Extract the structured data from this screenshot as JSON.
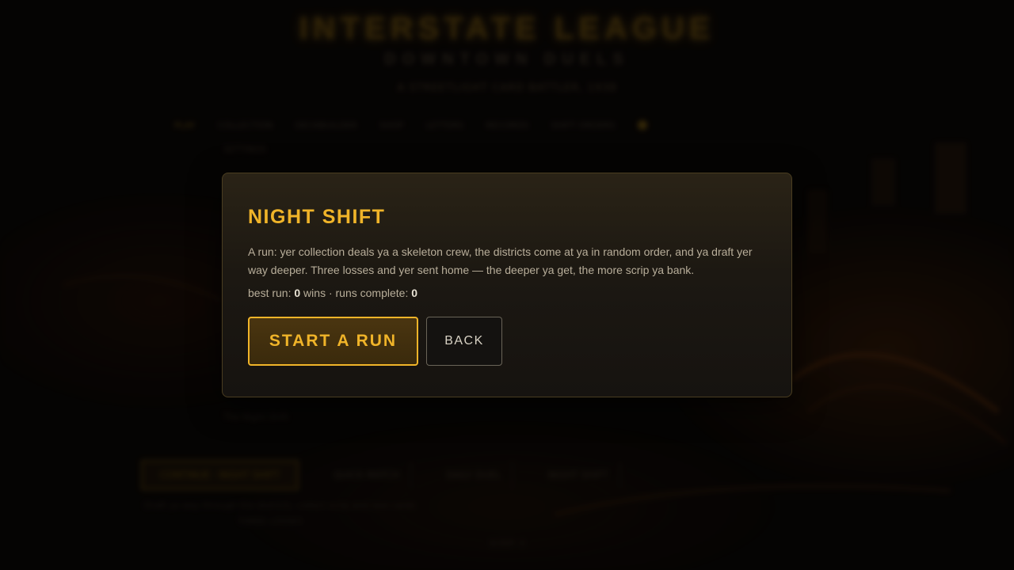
{
  "background": {
    "title": "INTERSTATE LEAGUE",
    "subtitle": "DOWNTOWN DUELS",
    "tagline": "A STREETLIGHT CARD BATTLER, 1938",
    "nav": [
      "PLAY",
      "COLLECTION",
      "DECKBUILDER",
      "SHOP",
      "LETTERS",
      "RECORDS",
      "SHIFT ORDERS"
    ],
    "small_link": "SETTINGS",
    "small_note": "The Night Shift",
    "bottom": {
      "primary": "CONTINUE · NIGHT SHIFT",
      "second": "QUICK MATCH",
      "third": "DAILY DUEL",
      "fourth": "NIGHT SHIFT"
    },
    "foot1": "Draft ya way through the districts, collect scrip and rare cards",
    "foot2": "THREE LOSSES",
    "foot3": "SCRIP: 0"
  },
  "modal": {
    "title": "NIGHT SHIFT",
    "description": "A run: yer collection deals ya a skeleton crew, the districts come at ya in random order, and ya draft yer way deeper. Three losses and yer sent home — the deeper ya get, the more scrip ya bank.",
    "stats": {
      "best_run_label": "best run: ",
      "best_run_value": "0",
      "wins_label": " wins · runs complete: ",
      "runs_value": "0"
    },
    "start_button": "START A RUN",
    "back_button": "BACK"
  },
  "colors": {
    "accent": "#f0b429",
    "text": "#b8ae9a",
    "panel": "#1c1812"
  }
}
